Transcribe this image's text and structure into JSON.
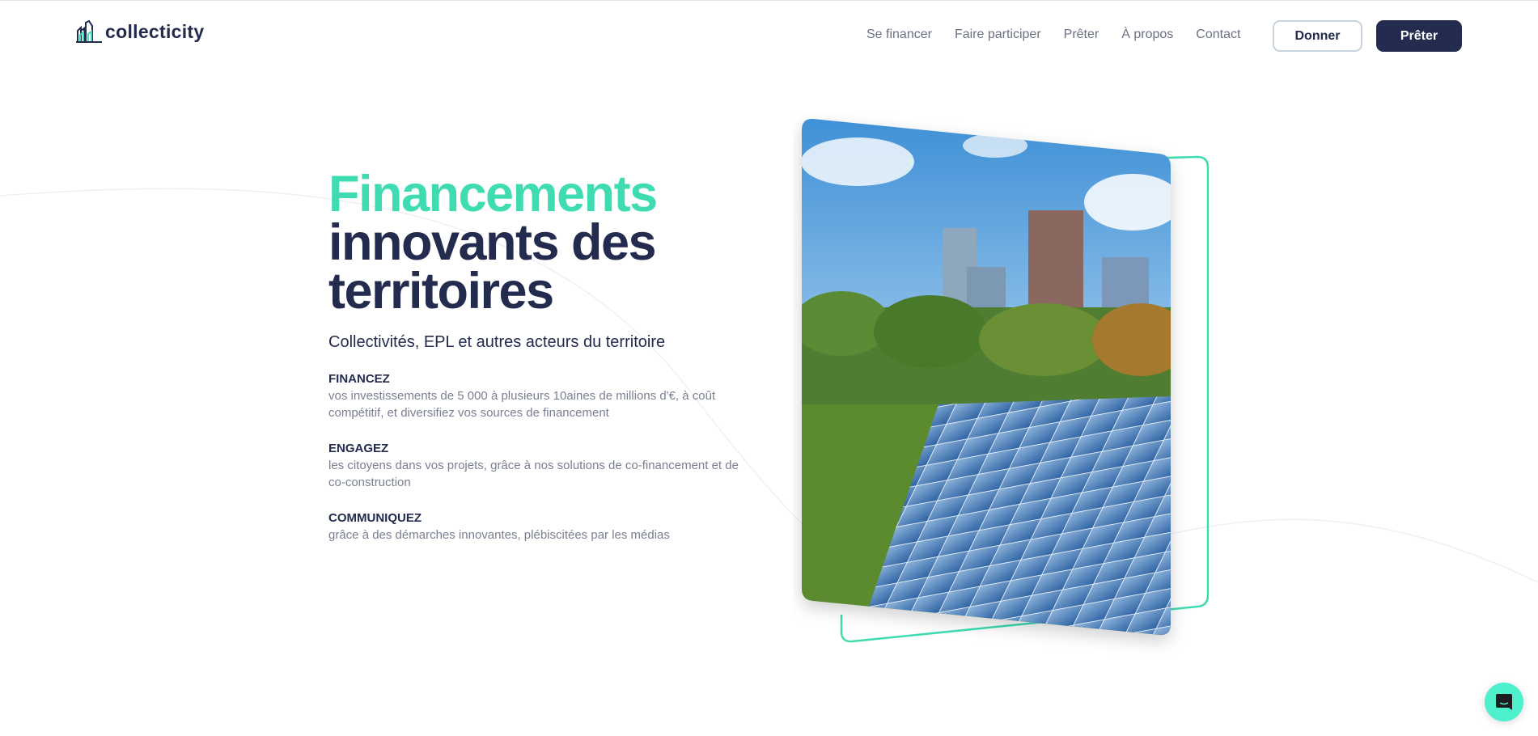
{
  "brand": {
    "name": "collecticity"
  },
  "nav": {
    "items": [
      "Se financer",
      "Faire participer",
      "Prêter",
      "À propos",
      "Contact"
    ],
    "donner": "Donner",
    "preter": "Prêter"
  },
  "hero": {
    "title_accent": "Financements",
    "title_line2": "innovants des",
    "title_line3": "territoires",
    "subtitle": "Collectivités, EPL et autres acteurs du territoire",
    "items": [
      {
        "title": "FINANCEZ",
        "text": "vos investissements de 5 000 à plusieurs 10aines de millions d'€, à coût compétitif, et diversifiez vos sources de financement"
      },
      {
        "title": "ENGAGEZ",
        "text": "les citoyens dans vos projets, grâce à nos solutions de co-financement et de co-construction"
      },
      {
        "title": "COMMUNIQUEZ",
        "text": "grâce à des démarches innovantes, plébiscitées par les médias"
      }
    ]
  },
  "colors": {
    "accent": "#3fdcb1",
    "navy": "#232b4e",
    "chat": "#4ef0cc"
  },
  "icons": {
    "chat": "chat-icon",
    "logo": "city-buildings-logo"
  }
}
